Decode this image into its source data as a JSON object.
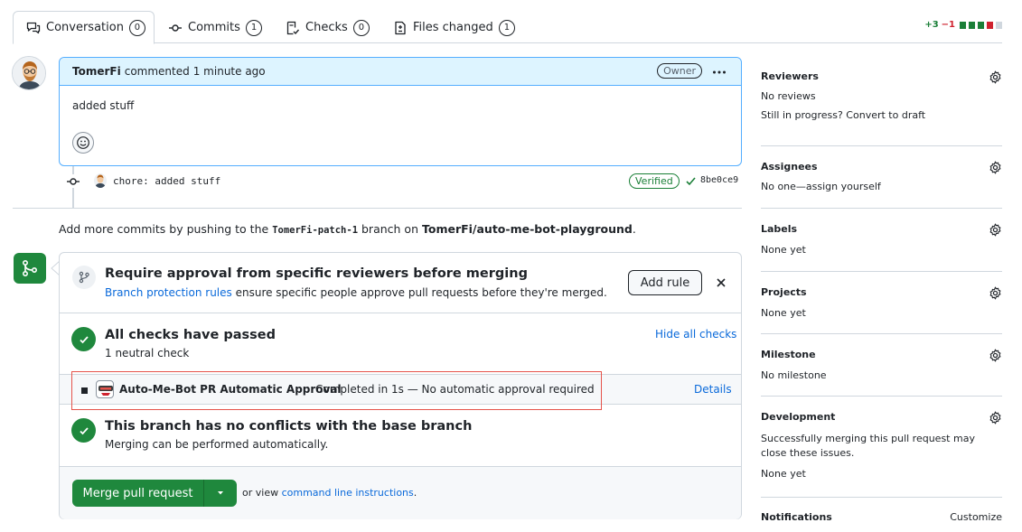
{
  "tabs": [
    {
      "label": "Conversation",
      "count": "0"
    },
    {
      "label": "Commits",
      "count": "1"
    },
    {
      "label": "Checks",
      "count": "0"
    },
    {
      "label": "Files changed",
      "count": "1"
    }
  ],
  "diffstat": {
    "additions": "+3",
    "deletions": "−1",
    "colors": [
      "#1a7f37",
      "#1a7f37",
      "#1a7f37",
      "#cf222e",
      "#d0d7de"
    ]
  },
  "comment": {
    "author": "TomerFi",
    "action": "commented",
    "time": "1 minute ago",
    "badge": "Owner",
    "body": "added stuff"
  },
  "commit": {
    "message": "chore: added stuff",
    "verified": "Verified",
    "sha": "8be0ce9"
  },
  "push_message": {
    "prefix": "Add more commits by pushing to the",
    "branch": "TomerFi-patch-1",
    "middle": "branch on",
    "repo": "TomerFi/auto-me-bot-playground",
    "suffix": "."
  },
  "mergebox": {
    "protection": {
      "title": "Require approval from specific reviewers before merging",
      "link": "Branch protection rules",
      "text": "ensure specific people approve pull requests before they're merged.",
      "add_rule": "Add rule"
    },
    "checks": {
      "title": "All checks have passed",
      "subtitle": "1 neutral check",
      "hide": "Hide all checks",
      "row": {
        "name": "Auto-Me-Bot PR Automatic Approval",
        "status": "Completed in 1s — No automatic approval required",
        "details": "Details"
      }
    },
    "conflicts": {
      "title": "This branch has no conflicts with the base branch",
      "subtitle": "Merging can be performed automatically."
    },
    "merge": {
      "button": "Merge pull request",
      "or_view": "or view",
      "cli_link": "command line instructions",
      "suffix": "."
    }
  },
  "sidebar": {
    "reviewers": {
      "heading": "Reviewers",
      "line1": "No reviews",
      "line2": "Still in progress? Convert to draft"
    },
    "assignees": {
      "heading": "Assignees",
      "value": "No one—assign yourself"
    },
    "labels": {
      "heading": "Labels",
      "value": "None yet"
    },
    "projects": {
      "heading": "Projects",
      "value": "None yet"
    },
    "milestone": {
      "heading": "Milestone",
      "value": "No milestone"
    },
    "development": {
      "heading": "Development",
      "text": "Successfully merging this pull request may close these issues.",
      "value": "None yet"
    },
    "notifications": {
      "heading": "Notifications",
      "action": "Customize"
    }
  }
}
